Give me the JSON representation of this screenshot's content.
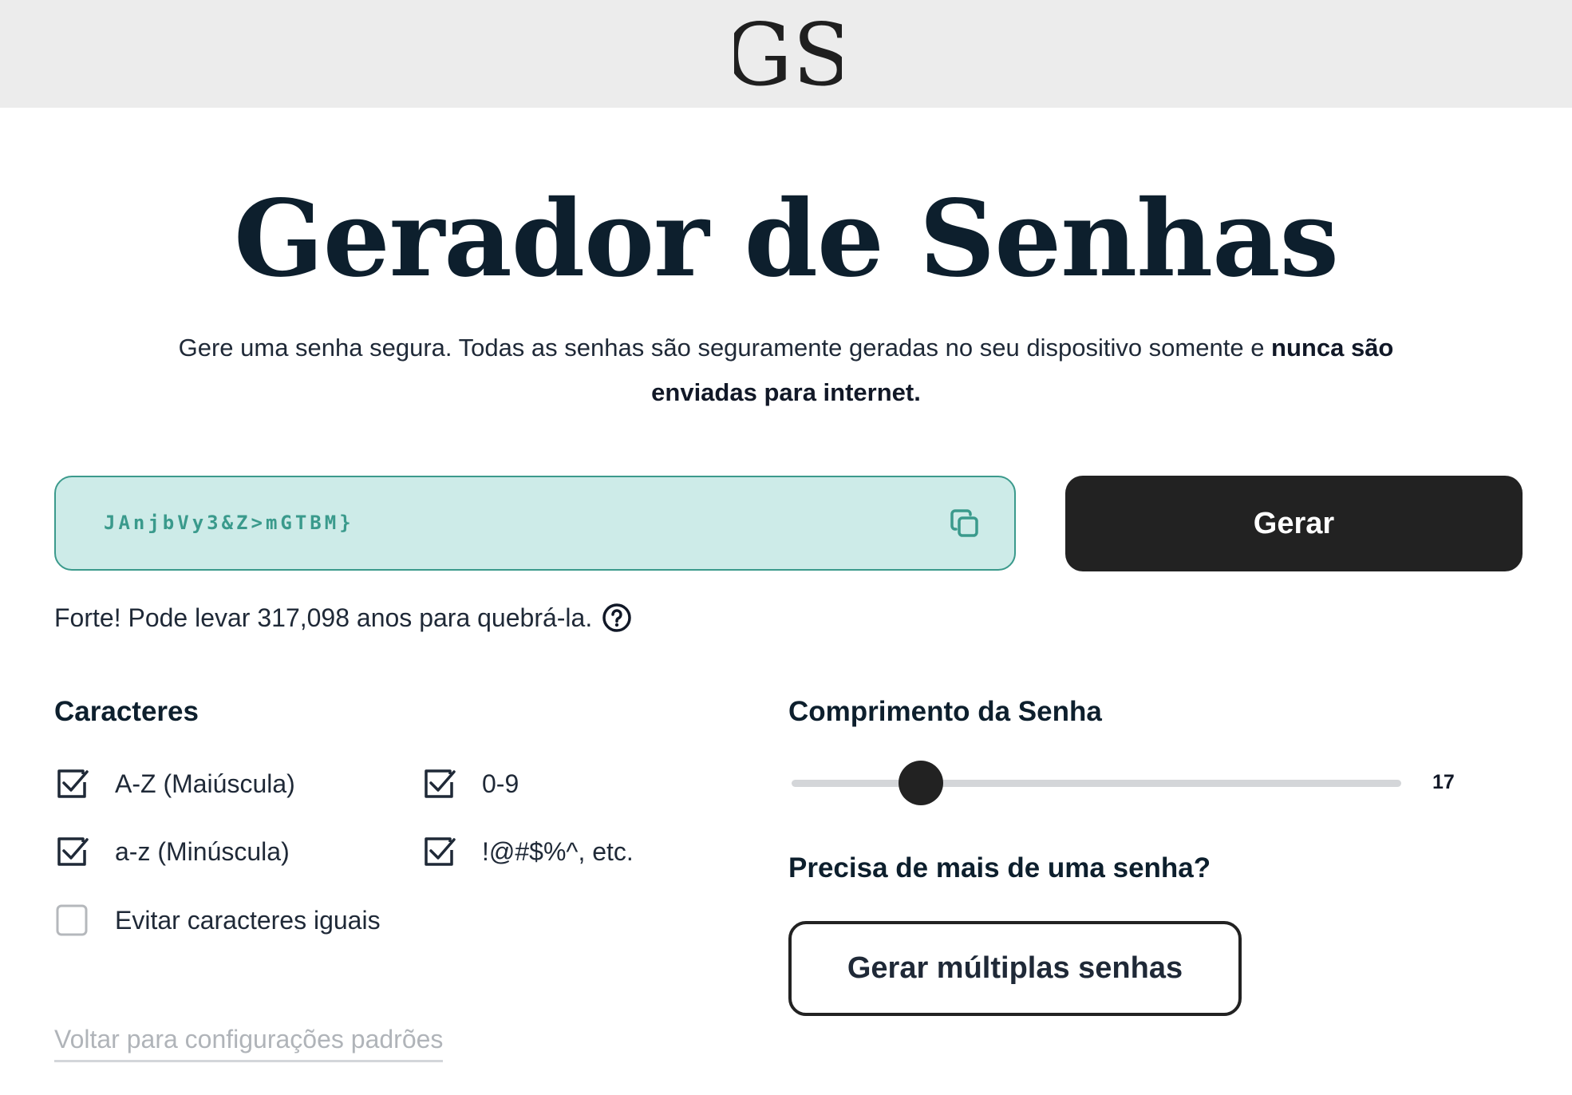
{
  "header": {
    "logo_text": "GS"
  },
  "main": {
    "title": "Gerador de Senhas",
    "subtitle_part1": "Gere uma senha segura. Todas as senhas são seguramente geradas no seu dispositivo somente e ",
    "subtitle_bold": "nunca são enviadas para internet."
  },
  "generator": {
    "password": "JAnjbVy3&Z>mGTBM}",
    "copy_icon": "copy-icon",
    "generate_label": "Gerar",
    "strength_text": "Forte! Pode levar 317,098 anos para quebrá-la.",
    "help_icon": "question-circle-icon"
  },
  "characters": {
    "title": "Caracteres",
    "options": [
      {
        "label": "A-Z (Maiúscula)",
        "checked": true
      },
      {
        "label": "0-9",
        "checked": true
      },
      {
        "label": "a-z (Minúscula)",
        "checked": true
      },
      {
        "label": "!@#$%^, etc.",
        "checked": true
      },
      {
        "label": "Evitar caracteres iguais",
        "checked": false
      }
    ],
    "reset_label": "Voltar para configurações padrões"
  },
  "length": {
    "title": "Comprimento da Senha",
    "value": "17",
    "fraction": 0.212
  },
  "multiple": {
    "title": "Precisa de mais de uma senha?",
    "button_label": "Gerar múltiplas senhas"
  },
  "colors": {
    "accent": "#3b9a8c",
    "password_bg": "#cdebe8",
    "dark": "#222222",
    "heading": "#0d1f2d"
  }
}
